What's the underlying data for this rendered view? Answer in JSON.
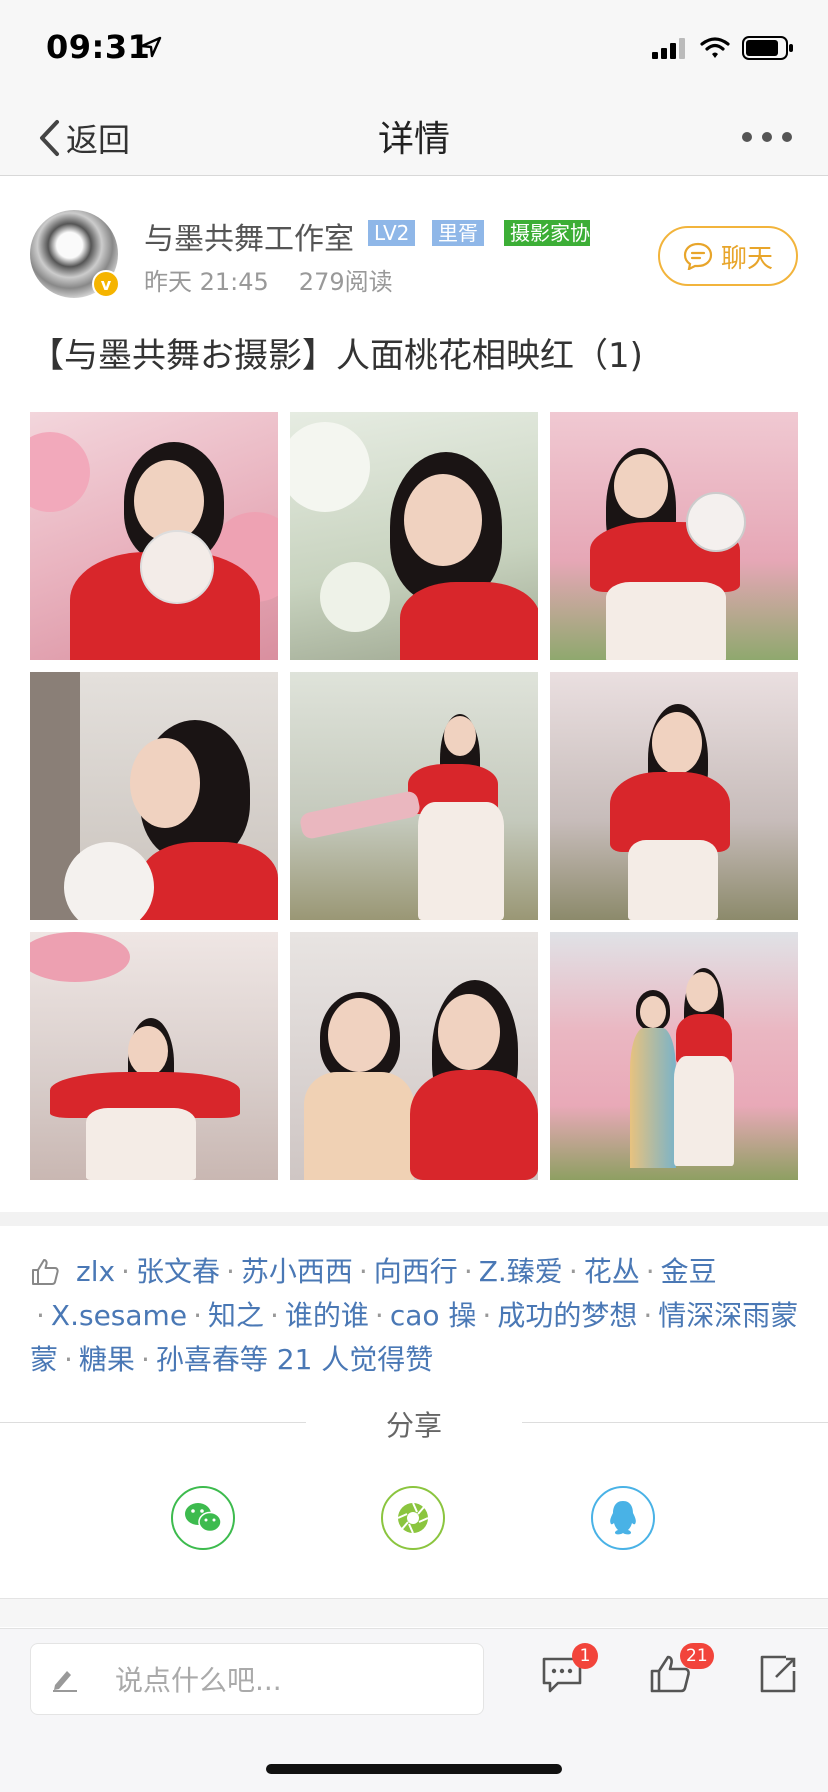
{
  "status_bar": {
    "time": "09:31"
  },
  "nav": {
    "back_label": "返回",
    "title": "详情"
  },
  "author": {
    "name": "与墨共舞工作室",
    "tags": [
      "LV2",
      "里胥",
      "摄影家协"
    ],
    "time": "昨天 21:45",
    "reads": "279阅读",
    "chat_label": "聊天"
  },
  "post": {
    "title": "【与墨共舞お摄影】人面桃花相映红（1)",
    "photos": [
      {
        "scene": "peach-blossom-fan"
      },
      {
        "scene": "white-blossom-portrait"
      },
      {
        "scene": "peach-blossom-fan-raised"
      },
      {
        "scene": "profile-tree"
      },
      {
        "scene": "orchard-ribbon"
      },
      {
        "scene": "orchard-standing"
      },
      {
        "scene": "arms-raised"
      },
      {
        "scene": "two-girls-close"
      },
      {
        "scene": "two-girls-orchard"
      }
    ]
  },
  "likes": {
    "names": [
      "zlx",
      "张文春",
      "苏小西西",
      "向西行",
      "Z.臻爱",
      "花丛",
      "金豆",
      "X.sesame",
      "知之",
      "谁的谁",
      "cao 操",
      "成功的梦想",
      "情深深雨蒙蒙",
      "糖果",
      "孙喜春"
    ],
    "suffix": "等 21 人觉得赞"
  },
  "share": {
    "title": "分享",
    "targets": [
      {
        "name": "wechat-icon"
      },
      {
        "name": "moments-icon"
      },
      {
        "name": "qq-icon"
      }
    ]
  },
  "toolbar": {
    "input_placeholder": "说点什么吧...",
    "comment_count": "1",
    "like_count": "21"
  },
  "colors": {
    "accent_orange": "#e8a52a",
    "link_blue": "#4a78b5",
    "badge_red": "#f2443b",
    "tag_blue": "#8fb7e8",
    "tag_green": "#3cae36"
  }
}
